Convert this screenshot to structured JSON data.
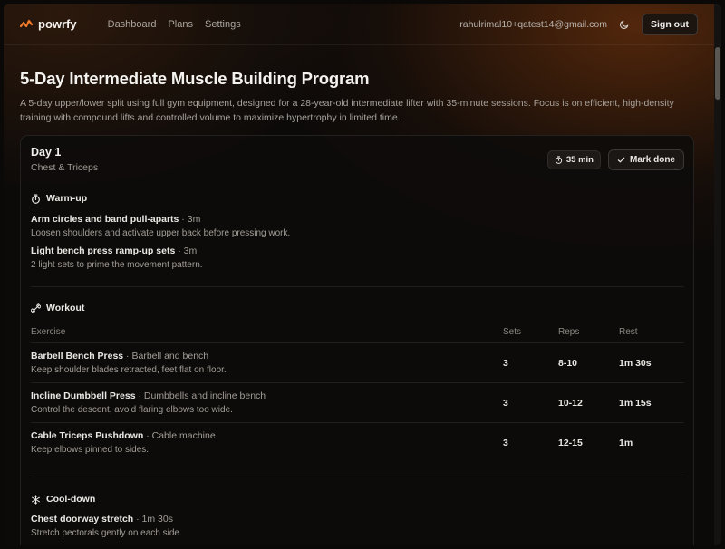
{
  "nav": {
    "brand": "powrfy",
    "links": [
      "Dashboard",
      "Plans",
      "Settings"
    ],
    "email": "rahulrimal10+qatest14@gmail.com",
    "signout": "Sign out"
  },
  "program": {
    "title": "5-Day Intermediate Muscle Building Program",
    "description": "A 5-day upper/lower split using full gym equipment, designed for a 28-year-old intermediate lifter with 35-minute sessions. Focus is on efficient, high-density training with compound lifts and controlled volume to maximize hypertrophy in limited time."
  },
  "day": {
    "title": "Day 1",
    "subtitle": "Chest & Triceps",
    "duration": "35 min",
    "mark_done": "Mark done",
    "warmup": {
      "heading": "Warm-up",
      "items": [
        {
          "name": "Arm circles and band pull-aparts",
          "duration": "3m",
          "note": "Loosen shoulders and activate upper back before pressing work."
        },
        {
          "name": "Light bench press ramp-up sets",
          "duration": "3m",
          "note": "2 light sets to prime the movement pattern."
        }
      ]
    },
    "workout": {
      "heading": "Workout",
      "columns": {
        "exercise": "Exercise",
        "sets": "Sets",
        "reps": "Reps",
        "rest": "Rest"
      },
      "rows": [
        {
          "name": "Barbell Bench Press",
          "equipment": "Barbell and bench",
          "note": "Keep shoulder blades retracted, feet flat on floor.",
          "sets": "3",
          "reps": "8-10",
          "rest": "1m 30s"
        },
        {
          "name": "Incline Dumbbell Press",
          "equipment": "Dumbbells and incline bench",
          "note": "Control the descent, avoid flaring elbows too wide.",
          "sets": "3",
          "reps": "10-12",
          "rest": "1m 15s"
        },
        {
          "name": "Cable Triceps Pushdown",
          "equipment": "Cable machine",
          "note": "Keep elbows pinned to sides.",
          "sets": "3",
          "reps": "12-15",
          "rest": "1m"
        }
      ]
    },
    "cooldown": {
      "heading": "Cool-down",
      "items": [
        {
          "name": "Chest doorway stretch",
          "duration": "1m 30s",
          "note": "Stretch pectorals gently on each side."
        }
      ]
    }
  },
  "icons": {
    "brand": "powrfy-logo-icon",
    "theme": "moon-icon",
    "timer": "stopwatch-icon",
    "check": "check-icon",
    "workout": "dumbbell-icon",
    "cooldown": "snowflake-icon"
  },
  "colors": {
    "brand_accent": "#f07a2a",
    "background": "#0c0a09"
  }
}
